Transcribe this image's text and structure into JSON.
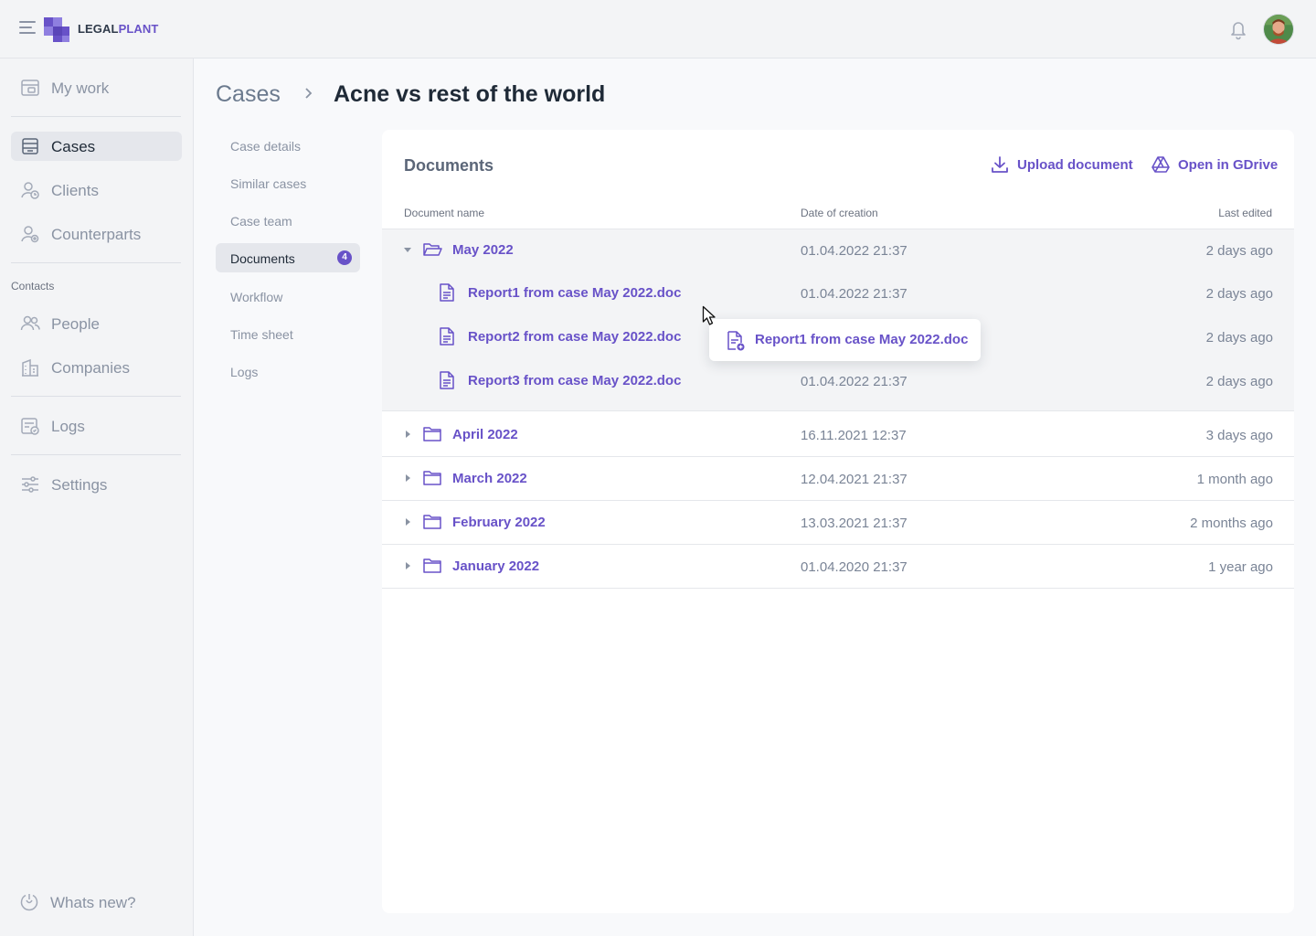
{
  "app": {
    "brand_part1": "LEGAL",
    "brand_part2": "PLANT",
    "accent_color": "#6852c8"
  },
  "sidebar": {
    "items": [
      {
        "label": "My work",
        "icon": "briefcase-icon"
      },
      {
        "label": "Cases",
        "icon": "archive-box-icon",
        "active": true
      },
      {
        "label": "Clients",
        "icon": "user-clock-icon"
      },
      {
        "label": "Counterparts",
        "icon": "user-settings-icon"
      }
    ],
    "contacts_label": "Contacts",
    "contacts": [
      {
        "label": "People",
        "icon": "people-icon"
      },
      {
        "label": "Companies",
        "icon": "building-icon"
      }
    ],
    "logs_label": "Logs",
    "settings_label": "Settings",
    "whats_new_label": "Whats new?"
  },
  "breadcrumb": {
    "root": "Cases",
    "current": "Acne vs rest of the world"
  },
  "subnav": {
    "items": [
      {
        "label": "Case details"
      },
      {
        "label": "Similar cases"
      },
      {
        "label": "Case team"
      },
      {
        "label": "Documents",
        "active": true,
        "badge": "4"
      },
      {
        "label": "Workflow"
      },
      {
        "label": "Time sheet"
      },
      {
        "label": "Logs"
      }
    ]
  },
  "documents": {
    "title": "Documents",
    "upload_label": "Upload document",
    "gdrive_label": "Open in GDrive",
    "columns": {
      "name": "Document name",
      "date": "Date of creation",
      "edited": "Last edited"
    },
    "expanded_folder": {
      "name": "May 2022",
      "date": "01.04.2022 21:37",
      "edited": "2 days ago",
      "files": [
        {
          "name": "Report1 from case May 2022.doc",
          "date": "01.04.2022 21:37",
          "edited": "2 days ago"
        },
        {
          "name": "Report2 from case May 2022.doc",
          "date": "",
          "edited": "2 days ago"
        },
        {
          "name": "Report3 from case May 2022.doc",
          "date": "01.04.2022 21:37",
          "edited": "2 days ago"
        }
      ]
    },
    "folders": [
      {
        "name": "April 2022",
        "date": "16.11.2021 12:37",
        "edited": "3 days ago"
      },
      {
        "name": "March 2022",
        "date": "12.04.2021 21:37",
        "edited": "1 month ago"
      },
      {
        "name": "February 2022",
        "date": "13.03.2021 21:37",
        "edited": "2 months ago"
      },
      {
        "name": "January 2022",
        "date": "01.04.2020 21:37",
        "edited": "1 year ago"
      }
    ],
    "drag_ghost_label": "Report1 from case May 2022.doc"
  }
}
